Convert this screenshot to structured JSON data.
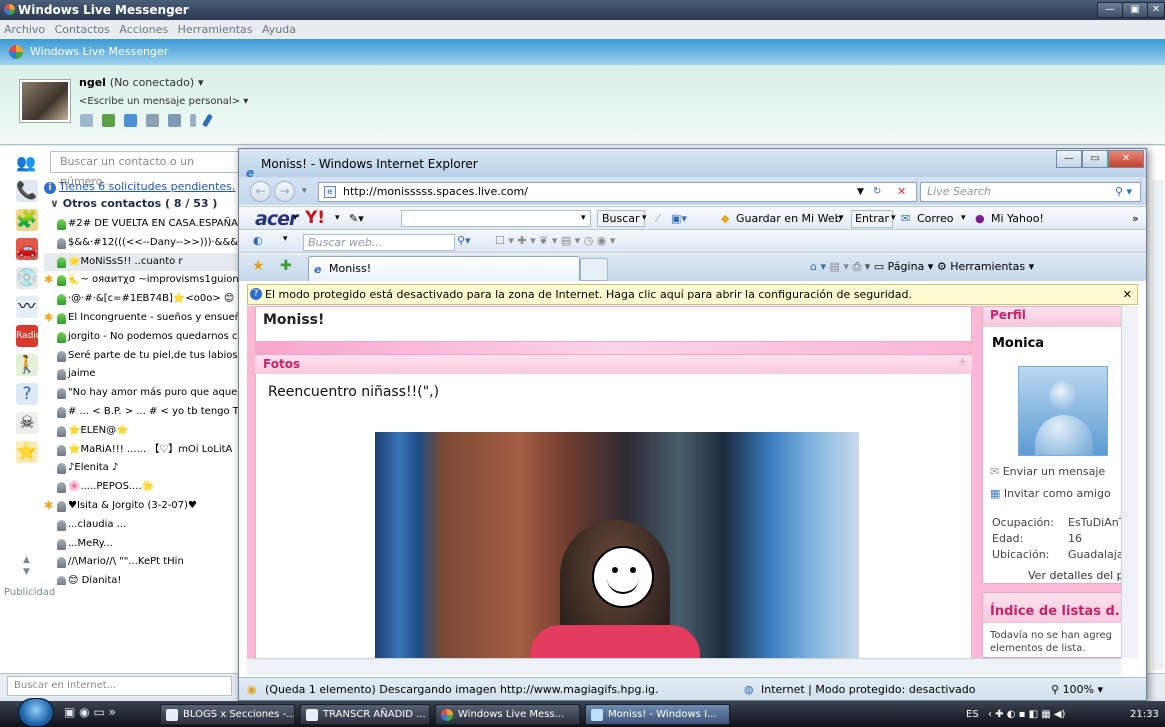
{
  "messenger": {
    "window_title": "Windows Live Messenger",
    "menu": [
      "Archivo",
      "Contactos",
      "Acciones",
      "Herramientas",
      "Ayuda"
    ],
    "band_title": "Windows Live Messenger",
    "user_name": "ngel",
    "user_status": "(No conectado)",
    "personal_message": "<Escribe un mensaje personal>",
    "search_placeholder": "Buscar un contacto o un número...",
    "pending": "Tienes 6 solicitudes pendientes.",
    "group_header": "Otros contactos ( 8 / 53 )",
    "contacts": [
      {
        "name": "#2# DE VUELTA EN CASA.ESPAÑA C",
        "online": true,
        "star": false
      },
      {
        "name": "$&&·#12(((<<--Dany-->>)))·&&&",
        "online": false,
        "star": false
      },
      {
        "name": "⭐MoNiSsS!!                ..cuanto r",
        "online": true,
        "star": false,
        "selected": true
      },
      {
        "name": "🌜~ ояαитχσ ~improvisms1guion d",
        "online": true,
        "star": true
      },
      {
        "name": "·@·#·&[c=#1EB74B]⭐<o0o> 😊",
        "online": true,
        "star": false
      },
      {
        "name": "El Incongruente  - sueños y ensueñ",
        "online": true,
        "star": true
      },
      {
        "name": "jorgito  - No podemos quedarnos co",
        "online": true,
        "star": false
      },
      {
        "name": "Seré parte de tu piel,de tus labios,de",
        "online": false,
        "star": false
      },
      {
        "name": "jaime",
        "online": false,
        "star": false
      },
      {
        "name": "\"No hay amor más puro que aquel qu",
        "online": false,
        "star": false
      },
      {
        "name": "# ... < B.P. > ... #  < yo tb tengo T",
        "online": false,
        "star": false
      },
      {
        "name": "⭐ELEN@⭐",
        "online": false,
        "star": false
      },
      {
        "name": "⭐MaRiA!!!  ......  【♡】mOi LoLitA",
        "online": false,
        "star": false
      },
      {
        "name": "♪Elenita ♪",
        "online": false,
        "star": false
      },
      {
        "name": "🌸.....PEPOS....🌟",
        "online": false,
        "star": false
      },
      {
        "name": "♥Isita & Jorgito (3-2-07)♥",
        "online": false,
        "star": true
      },
      {
        "name": "...claudia ...",
        "online": false,
        "star": false
      },
      {
        "name": "...MeRy...",
        "online": false,
        "star": false
      },
      {
        "name": "//\\Mario//\\               \"\"...KePt tHin",
        "online": false,
        "star": false
      },
      {
        "name": "😊 Dianita!",
        "online": false,
        "star": false
      }
    ],
    "publicidad": "Publicidad",
    "internet_search_placeholder": "Buscar en Internet..."
  },
  "ie": {
    "window_title": "Moniss! - Windows Internet Explorer",
    "url": "http://monisssss.spaces.live.com/",
    "live_search_placeholder": "Live Search",
    "acer_logo": "acer",
    "yahoo_logo": "Y!",
    "buscar": "Buscar",
    "guardar": "Guardar en Mi Web",
    "entrar": "Entrar",
    "correo": "Correo",
    "mi_yahoo": "Mi Yahoo!",
    "buscar_web_placeholder": "Buscar web...",
    "tab_label": "Moniss!",
    "pagina": "Página",
    "herramientas": "Herramientas",
    "infobar": "El modo protegido está desactivado para la zona de Internet. Haga clic aquí para abrir la configuración de seguridad.",
    "status_left": "(Queda 1 elemento) Descargando imagen http://www.magiagifs.hpg.ig.",
    "status_mode": "Internet | Modo protegido: desactivado",
    "zoom": "100%"
  },
  "space": {
    "title": "Moniss!",
    "fotos_header": "Fotos",
    "fotos_subtitle": "Reencuentro niñass!!(\",)",
    "perfil_header": "Perfil",
    "name": "Monica",
    "enviar": "Enviar un mensaje",
    "invitar": "Invitar como amigo",
    "ocupacion_label": "Ocupación:",
    "ocupacion_value": "EsTuDiAnT",
    "edad_label": "Edad:",
    "edad_value": "16",
    "ubicacion_label": "Ubicación:",
    "ubicacion_value": "Guadalaja",
    "ver_detalles": "Ver detalles del p",
    "indice_header": "Índice de listas d..",
    "indice_text": "Todavía no se han agreg elementos de lista."
  },
  "taskbar": {
    "items": [
      "BLOGS x Secciones -...",
      "TRANSCR AÑADID ...",
      "Windows Live Mess...",
      "Moniss! - Windows I..."
    ],
    "lang": "ES",
    "clock": "21:33"
  }
}
